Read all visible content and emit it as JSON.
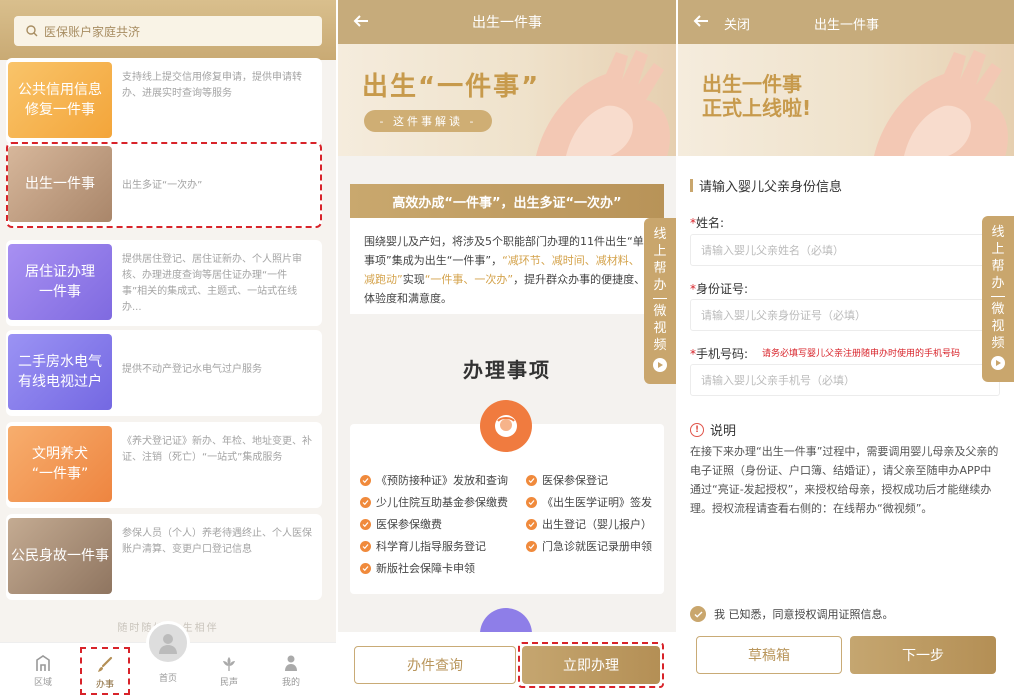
{
  "panel1": {
    "search_placeholder": "医保账户家庭共济",
    "services": [
      {
        "name_line1": "公共信用信息",
        "name_line2": "修复一件事",
        "desc": "支持线上提交信用修复申请，提供申请转办、进展实时查询等服务",
        "color": "#f7b24a"
      },
      {
        "name_line1": "出生一件事",
        "name_line2": "",
        "desc": "出生多证“一次办”",
        "color": "#c9a889"
      },
      {
        "name_line1": "居住证办理",
        "name_line2": "一件事",
        "desc": "提供居住登记、居住证新办、个人照片审核、办理进度查询等居住证办理“一件事”相关的集成式、主题式、一站式在线办...",
        "color": "#9b83ec"
      },
      {
        "name_line1": "二手房水电气",
        "name_line2": "有线电视过户",
        "desc": "提供不动产登记水电气过户服务",
        "color": "#8f86ee"
      },
      {
        "name_line1": "文明养犬",
        "name_line2": "“一件事”",
        "desc": "《养犬登记证》新办、年检、地址变更、补证、注销（死亡）“一站式”集成服务",
        "color": "#f39a5c"
      },
      {
        "name_line1": "公民身故一件事",
        "name_line2": "",
        "desc": "参保人员（个人）养老待遇终止、个人医保账户清算、变更户口登记信息",
        "color": "#b59a80"
      }
    ],
    "bottom_tip": "随时随地 一生相伴",
    "tabs": [
      {
        "label": "区域"
      },
      {
        "label": "办事"
      },
      {
        "label": "首页"
      },
      {
        "label": "民声"
      },
      {
        "label": "我的"
      }
    ]
  },
  "panel2": {
    "nav_title": "出生一件事",
    "banner_title": "出生“一件事”",
    "banner_pill": "- 这件事解读 -",
    "gold_bar": "高效办成“一件事”，出生多证“一次办”",
    "intro_1": "围绕婴儿及产妇，将涉及5个职能部门办理的11件出生“单事项”集成为出生“一件事”，",
    "intro_gold": "“减环节、减时间、减材料、减跑动”",
    "intro_2": "实现",
    "intro_gold2": "“一件事、一次办”",
    "intro_3": "，提升群众办事的便捷度、体验度和满意度。",
    "section_title": "办理事项",
    "items": [
      "《预防接种证》发放和查询",
      "医保参保登记",
      "少儿住院互助基金参保缴费",
      "《出生医学证明》签发",
      "医保参保缴费",
      "出生登记（婴儿报户）",
      "科学育儿指导服务登记",
      "门急诊就医记录册申领",
      "新版社会保障卡申领"
    ],
    "help_tab": {
      "line1": "线",
      "line2": "上",
      "line3": "帮",
      "line4": "办",
      "line5": "微",
      "line6": "视",
      "line7": "频"
    },
    "btn_query": "办件查询",
    "btn_apply": "立即办理"
  },
  "panel3": {
    "nav_close": "关闭",
    "nav_title": "出生一件事",
    "banner_line1": "出生一件事",
    "banner_line2": "正式上线啦!",
    "form_head": "请输入婴儿父亲身份信息",
    "name_label": "姓名:",
    "name_placeholder": "请输入婴儿父亲姓名（必填）",
    "id_label": "身份证号:",
    "id_placeholder": "请输入婴儿父亲身份证号（必填）",
    "phone_label": "手机号码:",
    "phone_warn": "请务必填写婴儿父亲注册随申办时使用的手机号码",
    "phone_placeholder": "请输入婴儿父亲手机号（必填）",
    "note_head": "说明",
    "note_body": "在接下来办理“出生一件事”过程中，需要调用婴儿母亲及父亲的电子证照（身份证、户口簿、结婚证），请父亲至随申办APP中通过“亮证-发起授权”，来授权给母亲，授权成功后才能继续办理。授权流程请查看右侧的：在线帮办“微视频”。",
    "agree_text": "我 已知悉，同意授权调用证照信息。",
    "btn_draft": "草稿箱",
    "btn_next": "下一步"
  }
}
